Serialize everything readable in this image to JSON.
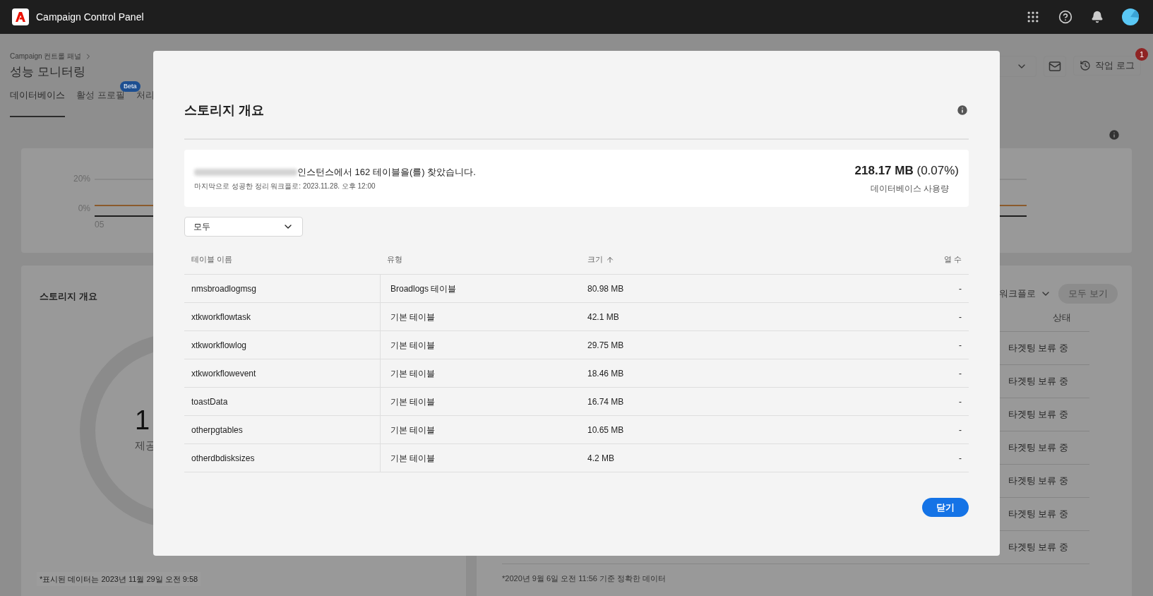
{
  "header": {
    "app_title": "Campaign Control Panel"
  },
  "page": {
    "breadcrumb": "Campaign 컨트롤 패널",
    "title": "성능 모니터링",
    "tabs": [
      {
        "label": "데이터베이스",
        "selected": true
      },
      {
        "label": "활성 프로필",
        "selected": false,
        "badge": "Beta"
      },
      {
        "label": "처리",
        "selected": false
      }
    ],
    "job_log_button": "작업 로그",
    "job_log_count": "1"
  },
  "usage_chart": {
    "ticks": [
      "20%",
      "0%"
    ],
    "x_label": "05"
  },
  "storage_card": {
    "title": "스토리지 개요",
    "donut_value": "1",
    "donut_label": "제공",
    "footnote": "*표시된 데이터는 2023년 11월 29일 오전 9:58"
  },
  "workflow_card": {
    "filter": "워크플로",
    "view_all": {
      "label": "모두 보기",
      "disabled": true
    },
    "column": "상태",
    "rows": [
      "타겟팅 보류 중",
      "타겟팅 보류 중",
      "타겟팅 보류 중",
      "타겟팅 보류 중",
      "타겟팅 보류 중",
      "타겟팅 보류 중",
      "타겟팅 보류 중"
    ],
    "footnote": "*2020년 9월 6일 오전 11:56 기준 정확한 데이터"
  },
  "dialog": {
    "title": "스토리지 개요",
    "summary": {
      "message": "인스턴스에서 162 테이블을(를) 찾았습니다.",
      "last_cleanup": "마지막으로 성공한 정리 워크플로: 2023.11.28. 오후 12:00",
      "usage": "**218.17 MB** (0.07%)",
      "usage_label": "데이터베이스 사용량"
    },
    "filter": "모두",
    "columns": [
      {
        "label": "테이블 이름"
      },
      {
        "label": "유형"
      },
      {
        "label": "크기",
        "sorted_ascending": true
      },
      {
        "label": "열 수"
      }
    ],
    "rows": [
      {
        "name": "nmsbroadlogmsg",
        "type": "Broadlogs 테이블",
        "size": "80.98 MB",
        "columns": "-"
      },
      {
        "name": "xtkworkflowtask",
        "type": "기본 테이블",
        "size": "42.1 MB",
        "columns": "-"
      },
      {
        "name": "xtkworkflowlog",
        "type": "기본 테이블",
        "size": "29.75 MB",
        "columns": "-"
      },
      {
        "name": "xtkworkflowevent",
        "type": "기본 테이블",
        "size": "18.46 MB",
        "columns": "-"
      },
      {
        "name": "toastData",
        "type": "기본 테이블",
        "size": "16.74 MB",
        "columns": "-"
      },
      {
        "name": "otherpgtables",
        "type": "기본 테이블",
        "size": "10.65 MB",
        "columns": "-"
      },
      {
        "name": "otherdbdisksizes",
        "type": "기본 테이블",
        "size": "4.2 MB",
        "columns": "-"
      }
    ],
    "close_button": "닫기"
  }
}
